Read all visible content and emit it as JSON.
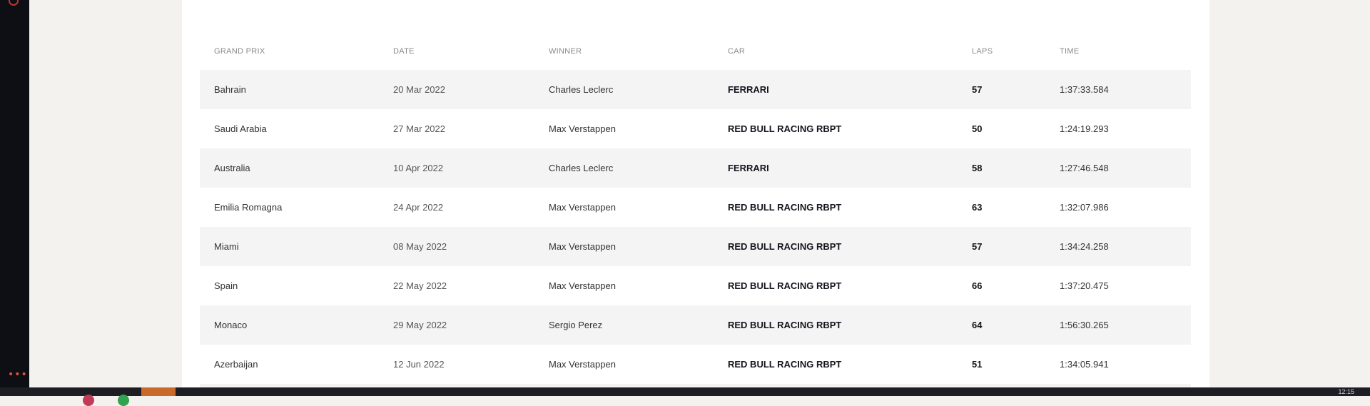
{
  "table": {
    "headers": {
      "grand_prix": "GRAND PRIX",
      "date": "DATE",
      "winner": "WINNER",
      "car": "CAR",
      "laps": "LAPS",
      "time": "TIME"
    },
    "rows": [
      {
        "grand_prix": "Bahrain",
        "date": "20 Mar 2022",
        "winner": "Charles Leclerc",
        "car": "FERRARI",
        "laps": "57",
        "time": "1:37:33.584"
      },
      {
        "grand_prix": "Saudi Arabia",
        "date": "27 Mar 2022",
        "winner": "Max Verstappen",
        "car": "RED BULL RACING RBPT",
        "laps": "50",
        "time": "1:24:19.293"
      },
      {
        "grand_prix": "Australia",
        "date": "10 Apr 2022",
        "winner": "Charles Leclerc",
        "car": "FERRARI",
        "laps": "58",
        "time": "1:27:46.548"
      },
      {
        "grand_prix": "Emilia Romagna",
        "date": "24 Apr 2022",
        "winner": "Max Verstappen",
        "car": "RED BULL RACING RBPT",
        "laps": "63",
        "time": "1:32:07.986"
      },
      {
        "grand_prix": "Miami",
        "date": "08 May 2022",
        "winner": "Max Verstappen",
        "car": "RED BULL RACING RBPT",
        "laps": "57",
        "time": "1:34:24.258"
      },
      {
        "grand_prix": "Spain",
        "date": "22 May 2022",
        "winner": "Max Verstappen",
        "car": "RED BULL RACING RBPT",
        "laps": "66",
        "time": "1:37:20.475"
      },
      {
        "grand_prix": "Monaco",
        "date": "29 May 2022",
        "winner": "Sergio Perez",
        "car": "RED BULL RACING RBPT",
        "laps": "64",
        "time": "1:56:30.265"
      },
      {
        "grand_prix": "Azerbaijan",
        "date": "12 Jun 2022",
        "winner": "Max Verstappen",
        "car": "RED BULL RACING RBPT",
        "laps": "51",
        "time": "1:34:05.941"
      }
    ]
  },
  "dock": {
    "menu_glyph": "•••",
    "top_icon": "gear-icon"
  },
  "taskbar": {
    "clock": "12:15"
  },
  "colors": {
    "accent": "#e0533c",
    "row_alt": "#f4f4f4",
    "page_bg": "#f4f2ef"
  }
}
